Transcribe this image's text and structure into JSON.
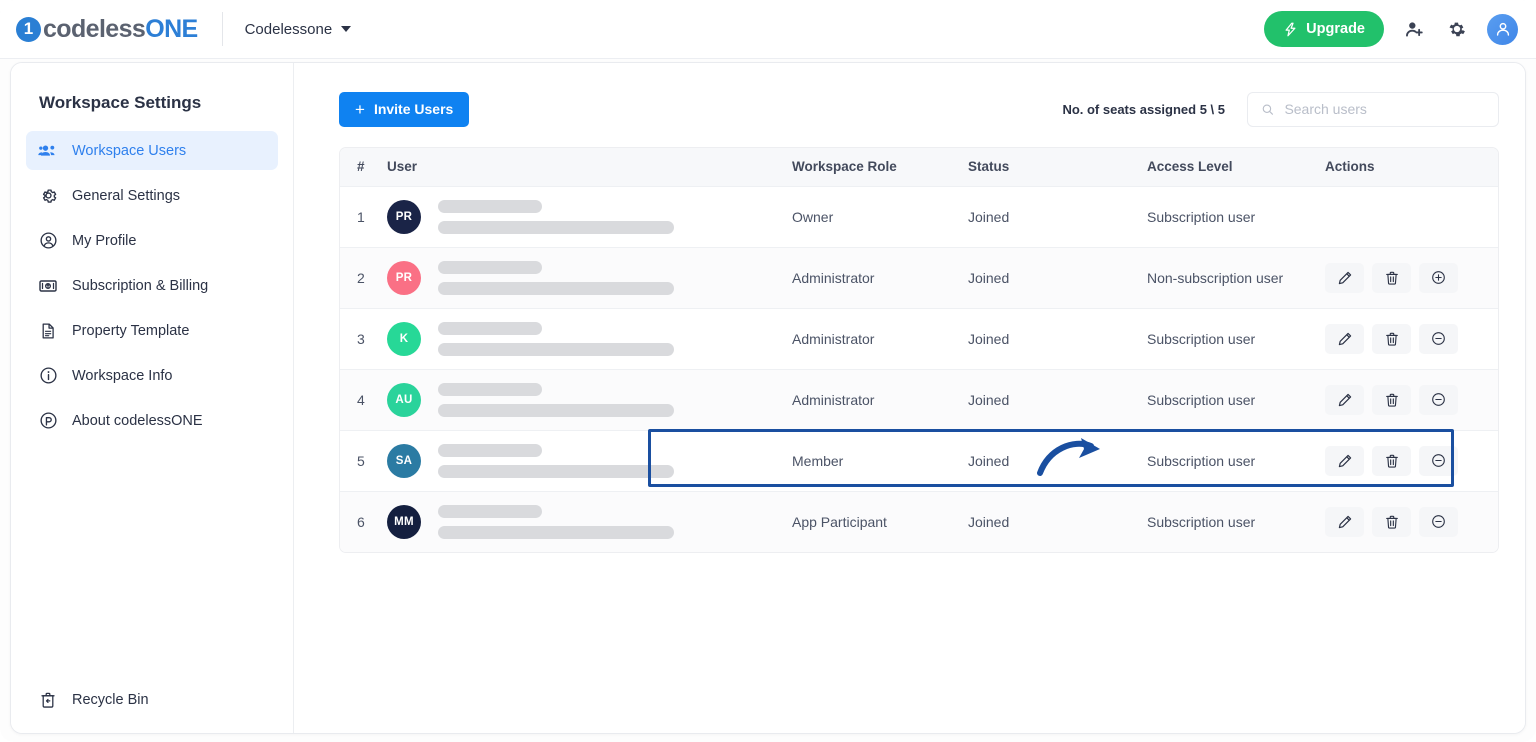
{
  "topbar": {
    "logo_text_left": "codeless",
    "logo_text_right": "ONE",
    "logo_mark_char": "1",
    "workspace_name": "Codelessone",
    "upgrade_label": "Upgrade",
    "icons": {
      "bolt": "bolt-icon",
      "add_user": "add-user-icon",
      "settings": "gear-icon",
      "avatar": "user-avatar-icon",
      "caret": "chevron-down-icon"
    }
  },
  "sidebar": {
    "title": "Workspace Settings",
    "items": [
      {
        "label": "Workspace Users",
        "icon": "users-icon",
        "active": true
      },
      {
        "label": "General Settings",
        "icon": "gear-icon",
        "active": false
      },
      {
        "label": "My Profile",
        "icon": "user-circle-icon",
        "active": false
      },
      {
        "label": "Subscription & Billing",
        "icon": "billing-icon",
        "active": false
      },
      {
        "label": "Property Template",
        "icon": "document-icon",
        "active": false
      },
      {
        "label": "Workspace Info",
        "icon": "info-circle-icon",
        "active": false
      },
      {
        "label": "About codelessONE",
        "icon": "about-icon",
        "active": false
      }
    ],
    "footer": {
      "label": "Recycle Bin",
      "icon": "recycle-bin-icon"
    }
  },
  "toolbar": {
    "invite_label": "Invite Users",
    "invite_plus": "+",
    "seats_text": "No. of seats assigned 5 \\ 5",
    "search_placeholder": "Search users",
    "search_value": "",
    "search_icon": "search-icon"
  },
  "table": {
    "headers": {
      "num": "#",
      "user": "User",
      "role": "Workspace Role",
      "status": "Status",
      "access": "Access Level",
      "actions": "Actions"
    },
    "rows": [
      {
        "num": "1",
        "initials": "PR",
        "avatar_color": "#1a2447",
        "role": "Owner",
        "status": "Joined",
        "access": "Subscription user",
        "has_actions": false,
        "toggle": ""
      },
      {
        "num": "2",
        "initials": "PR",
        "avatar_color": "#fa7085",
        "role": "Administrator",
        "status": "Joined",
        "access": "Non-subscription user",
        "has_actions": true,
        "toggle": "plus-circle-icon"
      },
      {
        "num": "3",
        "initials": "K",
        "avatar_color": "#27d897",
        "role": "Administrator",
        "status": "Joined",
        "access": "Subscription user",
        "has_actions": true,
        "toggle": "minus-circle-icon"
      },
      {
        "num": "4",
        "initials": "AU",
        "avatar_color": "#2ad39b",
        "role": "Administrator",
        "status": "Joined",
        "access": "Subscription user",
        "has_actions": true,
        "toggle": "minus-circle-icon"
      },
      {
        "num": "5",
        "initials": "SA",
        "avatar_color": "#2b7ba3",
        "role": "Member",
        "status": "Joined",
        "access": "Subscription user",
        "has_actions": true,
        "toggle": "minus-circle-icon"
      },
      {
        "num": "6",
        "initials": "MM",
        "avatar_color": "#141f3f",
        "role": "App Participant",
        "status": "Joined",
        "access": "Subscription user",
        "has_actions": true,
        "toggle": "minus-circle-icon"
      }
    ],
    "action_icons": {
      "edit": "pencil-icon",
      "delete": "trash-icon"
    }
  },
  "annotation": {
    "highlight_row_index": 3,
    "highlight_color": "#1a4fa0",
    "arrow_color": "#1a4fa0",
    "arrow_target": "Subscription user"
  },
  "colors": {
    "accent_blue": "#0f82f1",
    "upgrade_green": "#22c16b",
    "active_nav_bg": "#e8f1fe",
    "active_nav_text": "#2f80ed"
  }
}
